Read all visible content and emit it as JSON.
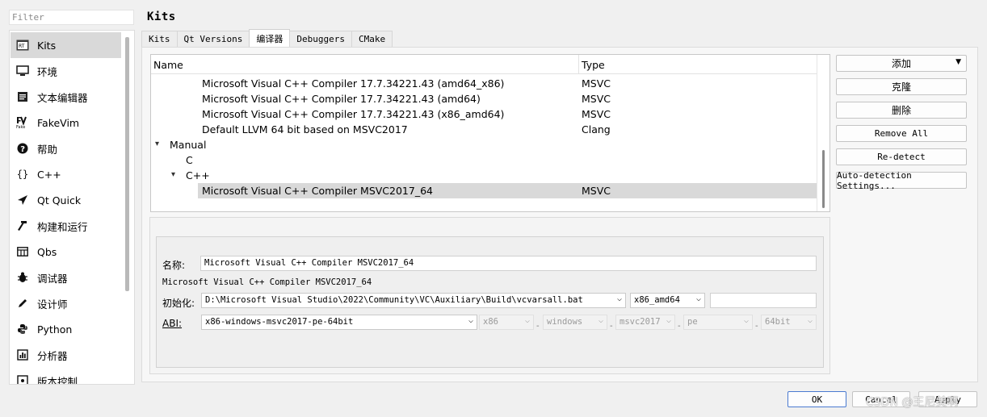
{
  "filter": {
    "placeholder": "Filter"
  },
  "sidebar": {
    "items": [
      {
        "label": "Kits",
        "icon": "kits-icon"
      },
      {
        "label": "环境",
        "icon": "monitor-icon"
      },
      {
        "label": "文本编辑器",
        "icon": "text-editor-icon"
      },
      {
        "label": "FakeVim",
        "icon": "fakevim-icon"
      },
      {
        "label": "帮助",
        "icon": "help-icon"
      },
      {
        "label": "C++",
        "icon": "braces-icon"
      },
      {
        "label": "Qt Quick",
        "icon": "qt-quick-icon"
      },
      {
        "label": "构建和运行",
        "icon": "hammer-icon"
      },
      {
        "label": "Qbs",
        "icon": "qbs-icon"
      },
      {
        "label": "调试器",
        "icon": "bug-icon"
      },
      {
        "label": "设计师",
        "icon": "pen-icon"
      },
      {
        "label": "Python",
        "icon": "python-icon"
      },
      {
        "label": "分析器",
        "icon": "analyzer-icon"
      },
      {
        "label": "版本控制",
        "icon": "version-control-icon"
      }
    ]
  },
  "page": {
    "title": "Kits"
  },
  "tabs": [
    {
      "label": "Kits"
    },
    {
      "label": "Qt Versions"
    },
    {
      "label": "编译器"
    },
    {
      "label": "Debuggers"
    },
    {
      "label": "CMake"
    }
  ],
  "tree": {
    "headers": {
      "name": "Name",
      "type": "Type"
    },
    "rows": [
      {
        "name": "Microsoft Visual C++ Compiler 17.7.34221.43 (amd64_x86)",
        "type": "MSVC"
      },
      {
        "name": "Microsoft Visual C++ Compiler 17.7.34221.43 (amd64)",
        "type": "MSVC"
      },
      {
        "name": "Microsoft Visual C++ Compiler 17.7.34221.43 (x86_amd64)",
        "type": "MSVC"
      },
      {
        "name": "Default LLVM 64 bit based on MSVC2017",
        "type": "Clang"
      },
      {
        "name": "Manual",
        "type": ""
      },
      {
        "name": "C",
        "type": ""
      },
      {
        "name": "C++",
        "type": ""
      },
      {
        "name": "Microsoft Visual C++ Compiler MSVC2017_64",
        "type": "MSVC"
      }
    ]
  },
  "buttons": {
    "add": "添加",
    "clone": "克隆",
    "remove": "删除",
    "remove_all": "Remove All",
    "redetect": "Re-detect",
    "auto_detection": "Auto-detection Settings..."
  },
  "details": {
    "name_label": "名称:",
    "name_value": "Microsoft Visual C++ Compiler MSVC2017_64",
    "description": "Microsoft Visual C++ Compiler MSVC2017_64",
    "init_label": "初始化:",
    "init_path": "D:\\Microsoft Visual Studio\\2022\\Community\\VC\\Auxiliary\\Build\\vcvarsall.bat",
    "init_arch": "x86_amd64",
    "init_extra": "",
    "abi_label": "ABI:",
    "abi_value": "x86-windows-msvc2017-pe-64bit",
    "abi_parts": [
      "x86",
      "windows",
      "msvc2017",
      "pe",
      "64bit"
    ],
    "dash": "-"
  },
  "footer": {
    "ok": "OK",
    "cancel": "Cancel",
    "apply": "Apply"
  },
  "watermark": "CSDN @王尼美啊"
}
